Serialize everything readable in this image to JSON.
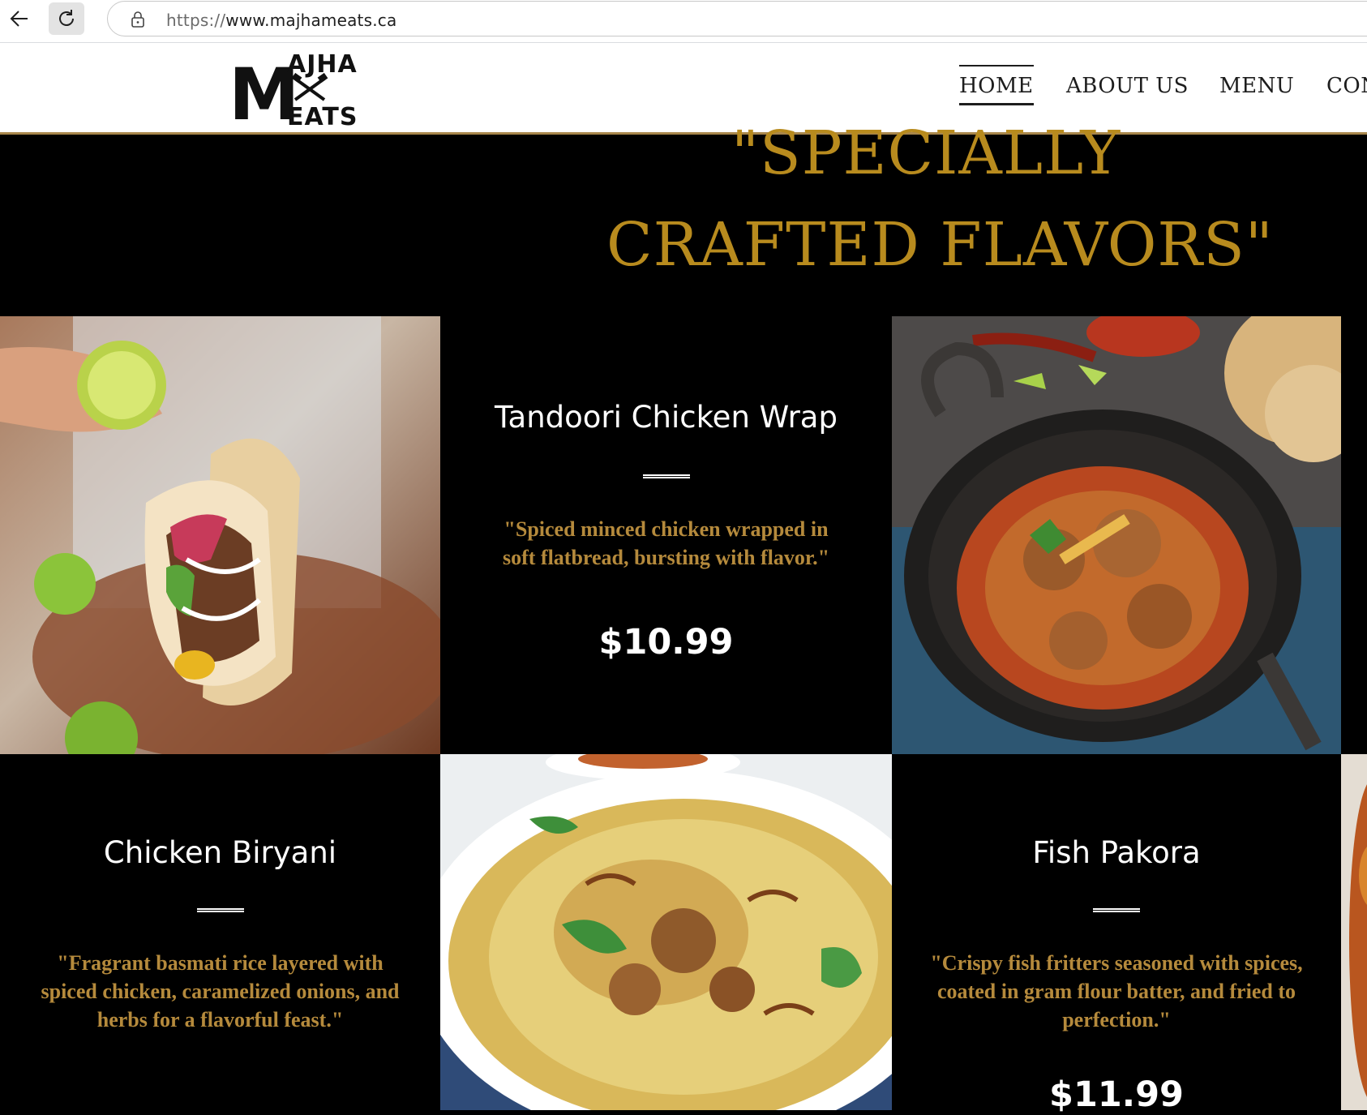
{
  "browser": {
    "url_scheme": "https://",
    "url_host": "www.majhameats.ca"
  },
  "site": {
    "logo": {
      "line1": "AJHA",
      "line2": "EATS",
      "big_letter": "M"
    },
    "nav": [
      {
        "label": "HOME",
        "active": true
      },
      {
        "label": "ABOUT US"
      },
      {
        "label": "MENU"
      },
      {
        "label": "CON"
      }
    ]
  },
  "hero": {
    "line1": "\"SPECIALLY",
    "line2": "CRAFTED FLAVORS\""
  },
  "menu_items": [
    {
      "title": "Tandoori Chicken Wrap",
      "desc_line1": "\"Spiced minced chicken wrapped in",
      "desc_line2": "soft flatbread, bursting with flavor.\"",
      "price": "$10.99"
    },
    {
      "title": "Chicken Biryani",
      "desc_line1": "\"Fragrant basmati rice layered with",
      "desc_line2": "spiced chicken, caramelized onions, and",
      "desc_line3": "herbs for a flavorful feast.\""
    },
    {
      "title": "Fish Pakora",
      "desc_line1": "\"Crispy fish fritters seasoned with spices,",
      "desc_line2": "coated in gram flour batter, and fried to",
      "desc_line3": "perfection.\"",
      "price": "$11.99"
    }
  ],
  "images": {
    "taco": "taco-photo",
    "curry": "curry-bowl-photo",
    "biryani": "biryani-plate-photo",
    "partial": "partial-dish-photo"
  },
  "colors": {
    "accent_gold": "#b88b1e",
    "desc_gold": "#b58a3c",
    "header_rule": "#a8864b",
    "background": "#000000"
  }
}
